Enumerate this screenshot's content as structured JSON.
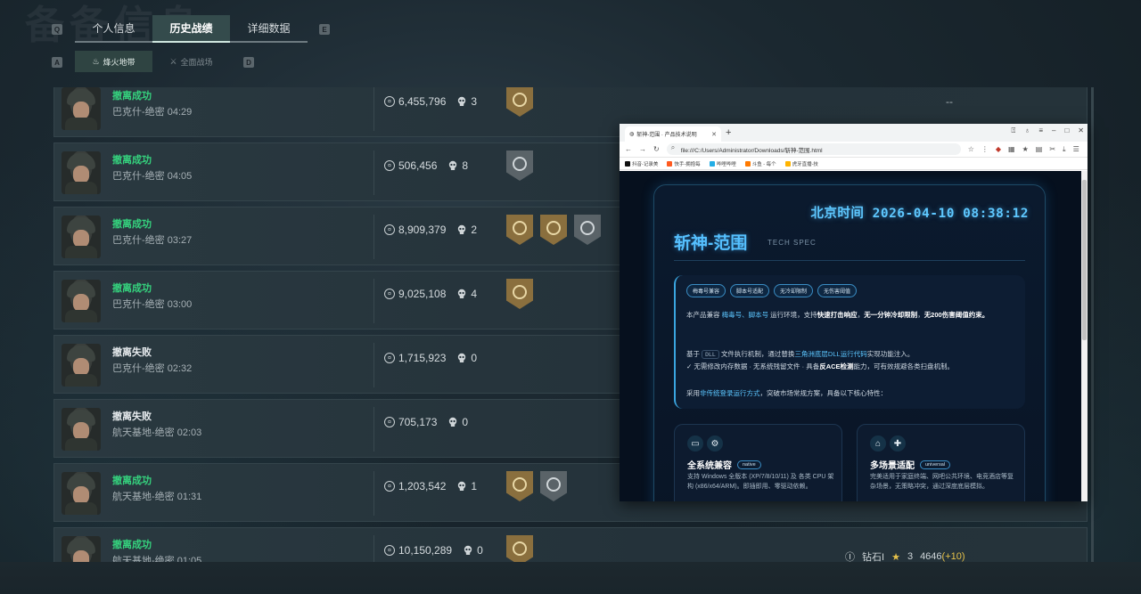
{
  "header": {
    "bg_title": "备备信息",
    "key_left": "Q",
    "key_right": "E",
    "tabs": [
      {
        "label": "个人信息",
        "active": false
      },
      {
        "label": "历史战绩",
        "active": true
      },
      {
        "label": "详细数据",
        "active": false
      }
    ],
    "sub_key_left": "A",
    "sub_key_right": "D",
    "subtabs": [
      {
        "label": "烽火地带",
        "active": true
      },
      {
        "label": "全面战场",
        "active": false
      }
    ]
  },
  "records": [
    {
      "status": "撤离成功",
      "result": "success",
      "map": "巴克什-绝密 04:29",
      "value": "6,455,796",
      "kills": "3",
      "badges": [
        "gold"
      ],
      "right": "--"
    },
    {
      "status": "撤离成功",
      "result": "success",
      "map": "巴克什-绝密 04:05",
      "value": "506,456",
      "kills": "8",
      "badges": [
        "silver"
      ],
      "right": ""
    },
    {
      "status": "撤离成功",
      "result": "success",
      "map": "巴克什-绝密 03:27",
      "value": "8,909,379",
      "kills": "2",
      "badges": [
        "gold",
        "gold",
        "silver"
      ],
      "right": ""
    },
    {
      "status": "撤离成功",
      "result": "success",
      "map": "巴克什-绝密 03:00",
      "value": "9,025,108",
      "kills": "4",
      "badges": [
        "gold"
      ],
      "right": ""
    },
    {
      "status": "撤离失败",
      "result": "fail",
      "map": "巴克什-绝密 02:32",
      "value": "1,715,923",
      "kills": "0",
      "badges": [],
      "right": ""
    },
    {
      "status": "撤离失败",
      "result": "fail",
      "map": "航天基地-绝密 02:03",
      "value": "705,173",
      "kills": "0",
      "badges": [],
      "right": ""
    },
    {
      "status": "撤离成功",
      "result": "success",
      "map": "航天基地-绝密 01:31",
      "value": "1,203,542",
      "kills": "1",
      "badges": [
        "gold",
        "silver"
      ],
      "right": ""
    },
    {
      "status": "撤离成功",
      "result": "success",
      "map": "航天基地-绝密 01:05",
      "value": "10,150,289",
      "kills": "0",
      "badges": [
        "gold"
      ],
      "right": ""
    }
  ],
  "rank": {
    "tier": "钻石I",
    "stars": "3",
    "score": "4646",
    "delta": "(+10)"
  },
  "browser": {
    "tab_title": "斩神-范围 · 产品技术说明",
    "url": "file:///C:/Users/Administrator/Downloads/斩神-范围.html",
    "bookmarks": [
      "抖音-记录美",
      "快手-拥抱每",
      "哔哩哔哩",
      "斗鱼 - 每个",
      "虎牙直播-技"
    ],
    "colors": {
      "accent": "#55c0ff",
      "page_bg": "#06101e"
    },
    "page": {
      "clock": "北京时间 2026-04-10 08:38:12",
      "title": "斩神-范围",
      "subtitle": "TECH SPEC",
      "pills": [
        "梅毒号兼容",
        "脚本号适配",
        "无冷却限制",
        "无伤害阈值"
      ],
      "para1_a": "本产品兼容 ",
      "para1_hl": "梅毒号、脚本号",
      "para1_b": " 运行环境，支持",
      "para1_bold1": "快速打击响应",
      "para1_c": "，",
      "para1_bold2": "无一分钟冷却限制",
      "para1_d": "，",
      "para1_bold3": "无200伤害阈值约束。",
      "para2_a": "基于 ",
      "para2_code": "DLL",
      "para2_b": " 文件执行机制，通过替换",
      "para2_hl": "三角洲底层DLL运行代码",
      "para2_c": "实现功能注入。",
      "para3_a": "✓ 无需修改内存数据 · 无系统残留文件 · 具备",
      "para3_bold": "反ACE检测",
      "para3_b": "能力，可有效规避各类扫盘机制。",
      "para4_a": "采用",
      "para4_hl": "非传统登录运行方式",
      "para4_b": "，突破市场常规方案，具备以下核心特性：",
      "features": [
        {
          "name": "全系统兼容",
          "tag": "native",
          "desc": "支持 Windows 全版本 (XP/7/8/10/11) 及 各类 CPU 架构 (x86/x64/ARM)。即插即用、零驱动依赖。"
        },
        {
          "name": "多场景适配",
          "tag": "universal",
          "desc": "完美适用于家庭终端、网吧公共环境、电竞酒店等复杂场景，无策略冲突，通过深度底层模拟。"
        }
      ]
    }
  }
}
